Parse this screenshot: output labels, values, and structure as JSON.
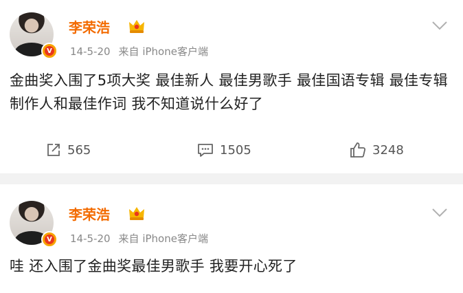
{
  "posts": [
    {
      "username": "李荣浩",
      "date": "14-5-20",
      "source": "来自 iPhone客户端",
      "content": "金曲奖入围了5项大奖 最佳新人 最佳男歌手 最佳国语专辑 最佳专辑制作人和最佳作词 我不知道说什么好了",
      "repost_count": "565",
      "comment_count": "1505",
      "like_count": "3248"
    },
    {
      "username": "李荣浩",
      "date": "14-5-20",
      "source": "来自 iPhone客户端",
      "content": "哇 还入围了金曲奖最佳男歌手 我要开心死了"
    }
  ],
  "icons": {
    "verified_badge": "verified-v-badge",
    "crown": "crown-icon",
    "chevron": "chevron-down-icon",
    "repost": "repost-icon",
    "comment": "comment-icon",
    "like": "like-icon"
  },
  "colors": {
    "username": "#f36b00",
    "background": "#f2f2f2",
    "card": "#ffffff"
  }
}
